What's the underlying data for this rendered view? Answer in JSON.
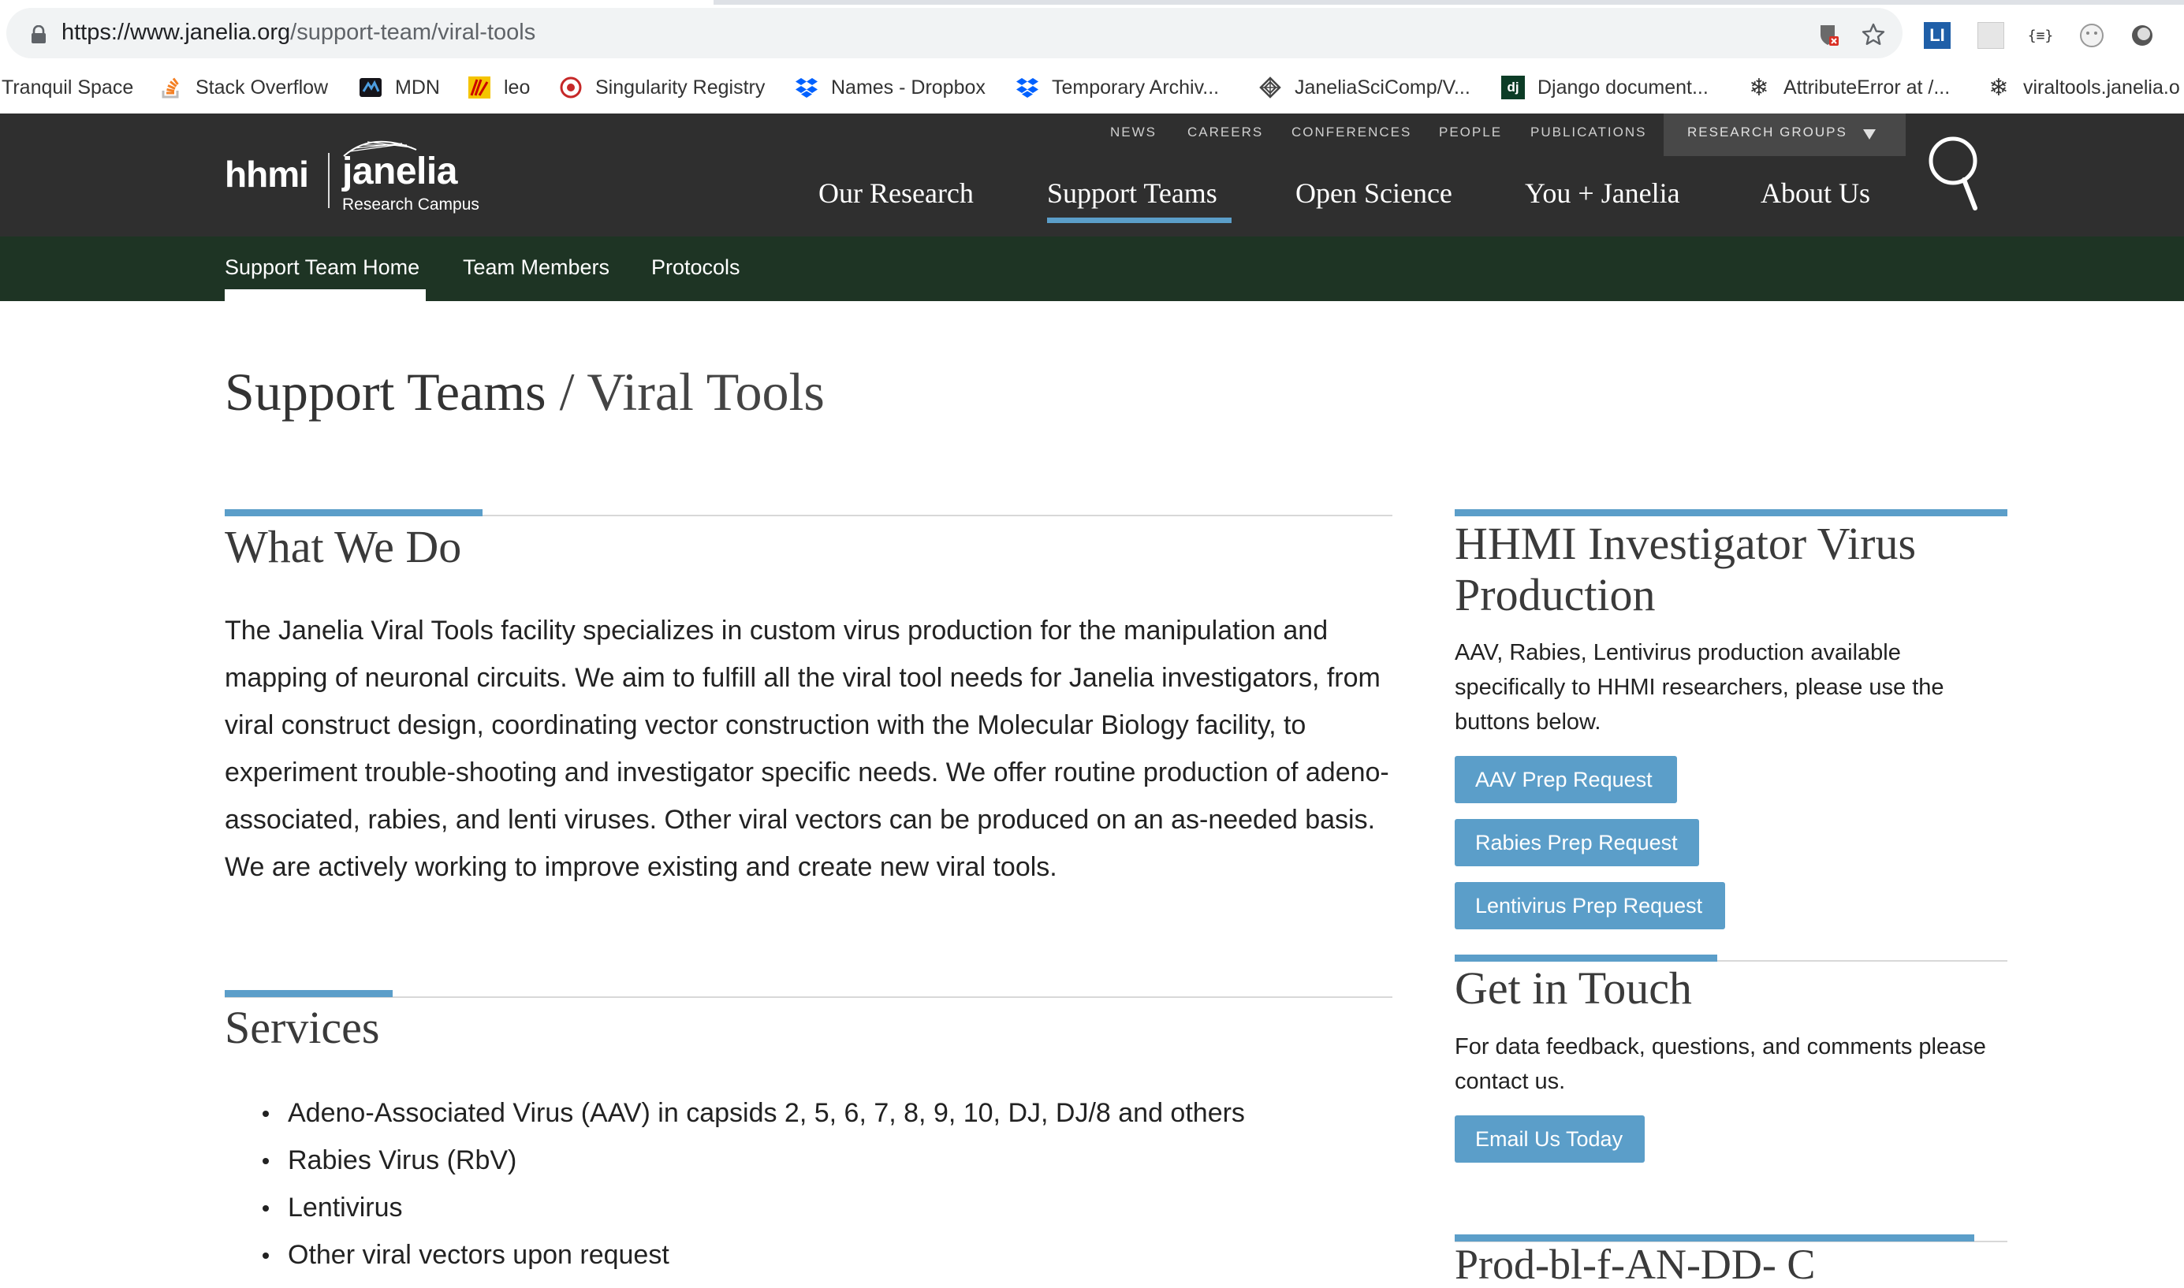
{
  "browser": {
    "url_host": "https://www.janelia.org",
    "url_path": "/support-team/viral-tools",
    "bookmarks": [
      {
        "label": "Tranquil Space",
        "icon": "none"
      },
      {
        "label": "Stack Overflow",
        "icon": "stackoverflow-icon"
      },
      {
        "label": "MDN",
        "icon": "mdn-icon"
      },
      {
        "label": "leo",
        "icon": "leo-icon"
      },
      {
        "label": "Singularity Registry",
        "icon": "singularity-icon"
      },
      {
        "label": "Names - Dropbox",
        "icon": "dropbox-icon"
      },
      {
        "label": "Temporary Archiv...",
        "icon": "dropbox-icon"
      },
      {
        "label": "JaneliaSciComp/V...",
        "icon": "github-icon"
      },
      {
        "label": "Django document...",
        "icon": "django-icon"
      },
      {
        "label": "AttributeError at /...",
        "icon": "snowflake-icon"
      },
      {
        "label": "viraltools.janelia.o",
        "icon": "snowflake-icon"
      }
    ],
    "extension_labels": {
      "tab_ext": "LI",
      "json_ext": "{≡}"
    }
  },
  "site": {
    "logo": {
      "hhmi": "hhmi",
      "janelia": "janelia",
      "campus": "Research Campus"
    },
    "utility_nav": [
      "NEWS",
      "CAREERS",
      "CONFERENCES",
      "PEOPLE",
      "PUBLICATIONS"
    ],
    "research_groups": "RESEARCH GROUPS",
    "main_nav": [
      "Our Research",
      "Support Teams",
      "Open Science",
      "You + Janelia",
      "About Us"
    ],
    "active_main_nav": "Support Teams",
    "sub_nav": [
      "Support Team Home",
      "Team Members",
      "Protocols"
    ],
    "active_sub_nav": "Support Team Home"
  },
  "page": {
    "title_parent": "Support Teams",
    "title_separator": " / ",
    "title_current": "Viral Tools"
  },
  "what_we_do": {
    "heading": "What We Do",
    "body": "The Janelia Viral Tools facility specializes in custom virus production for the manipulation and mapping of neuronal circuits. We aim to fulfill all the viral tool needs for Janelia investigators, from viral construct design, coordinating vector construction with the Molecular Biology facility, to experiment trouble-shooting and investigator specific needs. We offer routine production of adeno-associated, rabies, and lenti viruses. Other viral vectors can be produced on an as-needed basis. We are actively working to improve existing and create new viral tools."
  },
  "services": {
    "heading": "Services",
    "items": [
      "Adeno-Associated Virus (AAV) in capsids 2, 5, 6, 7, 8, 9, 10, DJ, DJ/8 and others",
      "Rabies Virus (RbV)",
      "Lentivirus",
      "Other viral vectors upon request"
    ]
  },
  "sidebar": {
    "virus_production": {
      "heading_line1": "HHMI Investigator Virus",
      "heading_line2": "Production",
      "body": "AAV, Rabies, Lentivirus production available specifically to HHMI researchers, please use the buttons below.",
      "buttons": [
        "AAV Prep Request",
        "Rabies Prep Request",
        "Lentivirus Prep Request"
      ]
    },
    "get_in_touch": {
      "heading": "Get in Touch",
      "body": "For data feedback, questions, and comments please contact us.",
      "button": "Email Us Today"
    },
    "next_section_heading": "Prod-bl-f-AN-DD- C"
  },
  "colors": {
    "header_bg": "#2f2f2f",
    "subnav_bg": "#1e3424",
    "accent_blue": "#5b9ec9",
    "text": "#222222"
  }
}
